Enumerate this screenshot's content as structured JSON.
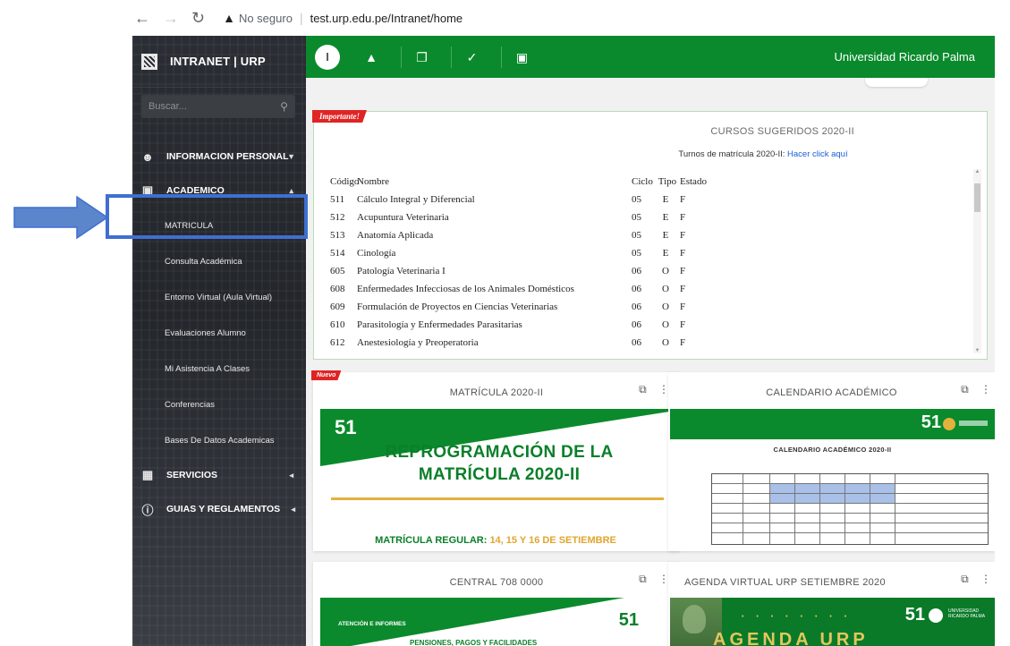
{
  "browser": {
    "back_icon": "back-arrow-icon",
    "insecure_label": "No seguro",
    "url": "test.urp.edu.pe/Intranet/home"
  },
  "sidebar": {
    "title": "INTRANET | URP",
    "search_placeholder": "Buscar...",
    "items": [
      {
        "label": "INFORMACION PERSONAL",
        "icon": "user-icon"
      },
      {
        "label": "ACADEMICO",
        "icon": "book-icon"
      },
      {
        "label": "SERVICIOS",
        "icon": "grid-icon"
      },
      {
        "label": "GUIAS Y REGLAMENTOS",
        "icon": "help-icon"
      }
    ],
    "academico_sub": [
      "MATRICULA",
      "Consulta Académica",
      "Entorno Virtual (Aula Virtual)",
      "Evaluaciones Alumno",
      "Mi Asistencia A Clases",
      "Conferencias",
      "Bases De Datos Academicas"
    ]
  },
  "topbar": {
    "user_initial": "I",
    "university": "Universidad Ricardo Palma"
  },
  "courses": {
    "badge": "Importante!",
    "title": "CURSOS SUGERIDOS 2020-II",
    "turnos_text": "Turnos de matrícula 2020-II:",
    "turnos_link": "Hacer click aquí",
    "headers": {
      "code": "Código",
      "name": "Nombre",
      "ciclo": "Ciclo",
      "tipo": "Tipo",
      "estado": "Estado"
    },
    "rows": [
      {
        "code": "511",
        "name": "Cálculo Integral y Diferencial",
        "ciclo": "05",
        "tipo": "E",
        "estado": "F"
      },
      {
        "code": "512",
        "name": "Acupuntura Veterinaria",
        "ciclo": "05",
        "tipo": "E",
        "estado": "F"
      },
      {
        "code": "513",
        "name": "Anatomía Aplicada",
        "ciclo": "05",
        "tipo": "E",
        "estado": "F"
      },
      {
        "code": "514",
        "name": "Cinología",
        "ciclo": "05",
        "tipo": "E",
        "estado": "F"
      },
      {
        "code": "605",
        "name": "Patología Veterinaria I",
        "ciclo": "06",
        "tipo": "O",
        "estado": "F"
      },
      {
        "code": "608",
        "name": "Enfermedades Infecciosas de los Animales Domésticos",
        "ciclo": "06",
        "tipo": "O",
        "estado": "F"
      },
      {
        "code": "609",
        "name": "Formulación de Proyectos en Ciencias Veterinarias",
        "ciclo": "06",
        "tipo": "O",
        "estado": "F"
      },
      {
        "code": "610",
        "name": "Parasitología y Enfermedades Parasitarias",
        "ciclo": "06",
        "tipo": "O",
        "estado": "F"
      },
      {
        "code": "612",
        "name": "Anestesiología y Preoperatoria",
        "ciclo": "06",
        "tipo": "O",
        "estado": "F"
      }
    ]
  },
  "cards": {
    "matricula": {
      "badge": "Nuevo",
      "title": "MATRÍCULA 2020-II",
      "logo": "51",
      "headline_1": "REPROGRAMACIÓN DE LA",
      "headline_2": "MATRÍCULA 2020-II",
      "regular_label": "MATRÍCULA REGULAR:",
      "regular_dates": "14, 15 Y 16 DE SETIEMBRE"
    },
    "calendario": {
      "title": "CALENDARIO ACADÉMICO",
      "logo": "51",
      "cal_title": "CALENDARIO ACADÉMICO 2020-II"
    },
    "central": {
      "title": "CENTRAL 708 0000",
      "atencion": "ATENCIÓN E INFORMES",
      "pensiones": "PENSIONES, PAGOS Y FACILIDADES",
      "logo": "51"
    },
    "agenda": {
      "title": "AGENDA VIRTUAL URP SETIEMBRE 2020",
      "logo": "51",
      "uname": "UNIVERSIDAD RICARDO PALMA",
      "agenda": "AGENDA URP"
    }
  },
  "colors": {
    "green": "#0a8a2c",
    "sidebar": "#26292e",
    "badge_red": "#e02424",
    "annotation_blue": "#3f6fd0",
    "gold": "#e4b13d"
  }
}
